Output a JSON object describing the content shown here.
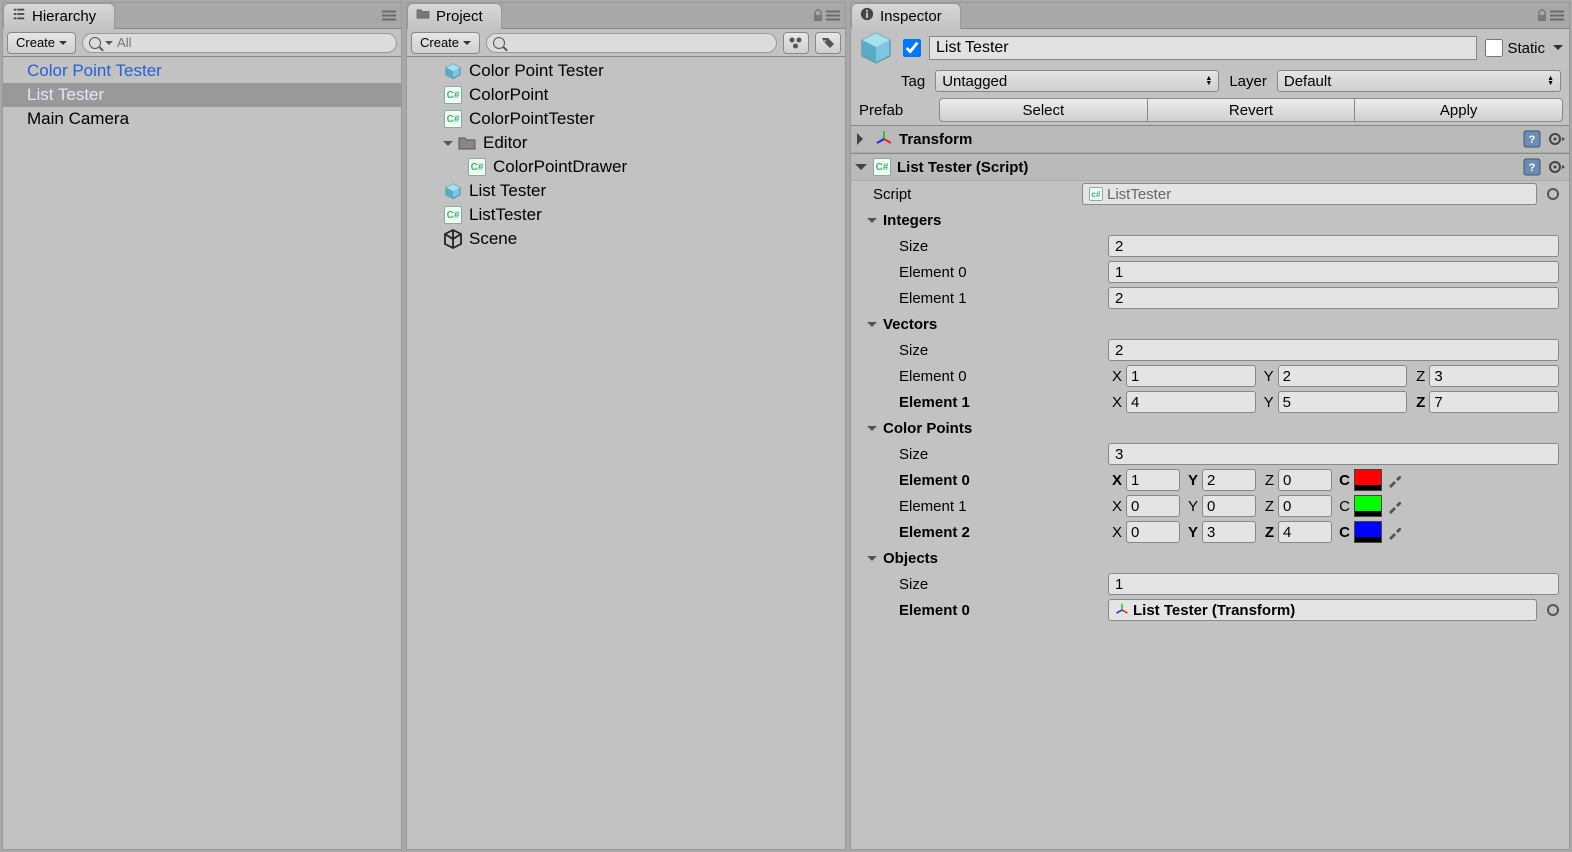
{
  "hierarchy": {
    "tab_label": "Hierarchy",
    "create_label": "Create",
    "search_placeholder": "All",
    "items": [
      "Color Point Tester",
      "List Tester",
      "Main Camera"
    ],
    "selected_index": 1
  },
  "project": {
    "tab_label": "Project",
    "create_label": "Create",
    "search_placeholder": "",
    "tree": {
      "items": [
        {
          "label": "Color Point Tester",
          "icon": "prefab"
        },
        {
          "label": "ColorPoint",
          "icon": "cs"
        },
        {
          "label": "ColorPointTester",
          "icon": "cs"
        },
        {
          "label": "Editor",
          "icon": "folder"
        },
        {
          "label": "ColorPointDrawer",
          "icon": "cs"
        },
        {
          "label": "List Tester",
          "icon": "prefab"
        },
        {
          "label": "ListTester",
          "icon": "cs"
        },
        {
          "label": "Scene",
          "icon": "unity"
        }
      ]
    }
  },
  "inspector": {
    "tab_label": "Inspector",
    "object_name": "List Tester",
    "static_label": "Static",
    "tag_label": "Tag",
    "tag_value": "Untagged",
    "layer_label": "Layer",
    "layer_value": "Default",
    "prefab_label": "Prefab",
    "prefab_buttons": [
      "Select",
      "Revert",
      "Apply"
    ],
    "transform": {
      "title": "Transform"
    },
    "list_tester": {
      "title": "List Tester (Script)",
      "script_label": "Script",
      "script_value": "ListTester",
      "integers": {
        "header": "Integers",
        "size_label": "Size",
        "size": "2",
        "elements": [
          "1",
          "2"
        ],
        "element_labels": [
          "Element 0",
          "Element 1"
        ]
      },
      "vectors": {
        "header": "Vectors",
        "size_label": "Size",
        "size": "2",
        "elements": [
          {
            "label": "Element 0",
            "bold": false,
            "x": "1",
            "y": "2",
            "z": "3",
            "xb": false,
            "yb": false,
            "zb": false
          },
          {
            "label": "Element 1",
            "bold": true,
            "x": "4",
            "y": "5",
            "z": "7",
            "xb": false,
            "yb": false,
            "zb": true
          }
        ]
      },
      "color_points": {
        "header": "Color Points",
        "size_label": "Size",
        "size": "3",
        "elements": [
          {
            "label": "Element 0",
            "bold": true,
            "x": "1",
            "y": "2",
            "z": "0",
            "xb": true,
            "yb": true,
            "zb": false,
            "cb": true,
            "color": "#ff0000"
          },
          {
            "label": "Element 1",
            "bold": false,
            "x": "0",
            "y": "0",
            "z": "0",
            "xb": false,
            "yb": false,
            "zb": false,
            "cb": false,
            "color": "#00ff00"
          },
          {
            "label": "Element 2",
            "bold": true,
            "x": "0",
            "y": "3",
            "z": "4",
            "xb": false,
            "yb": true,
            "zb": true,
            "cb": true,
            "color": "#0000ff"
          }
        ],
        "c_label": "C"
      },
      "objects": {
        "header": "Objects",
        "size_label": "Size",
        "size": "1",
        "elements": [
          {
            "label": "Element 0",
            "bold": true,
            "value": "List Tester (Transform)"
          }
        ]
      }
    }
  },
  "labels": {
    "x": "X",
    "y": "Y",
    "z": "Z"
  }
}
